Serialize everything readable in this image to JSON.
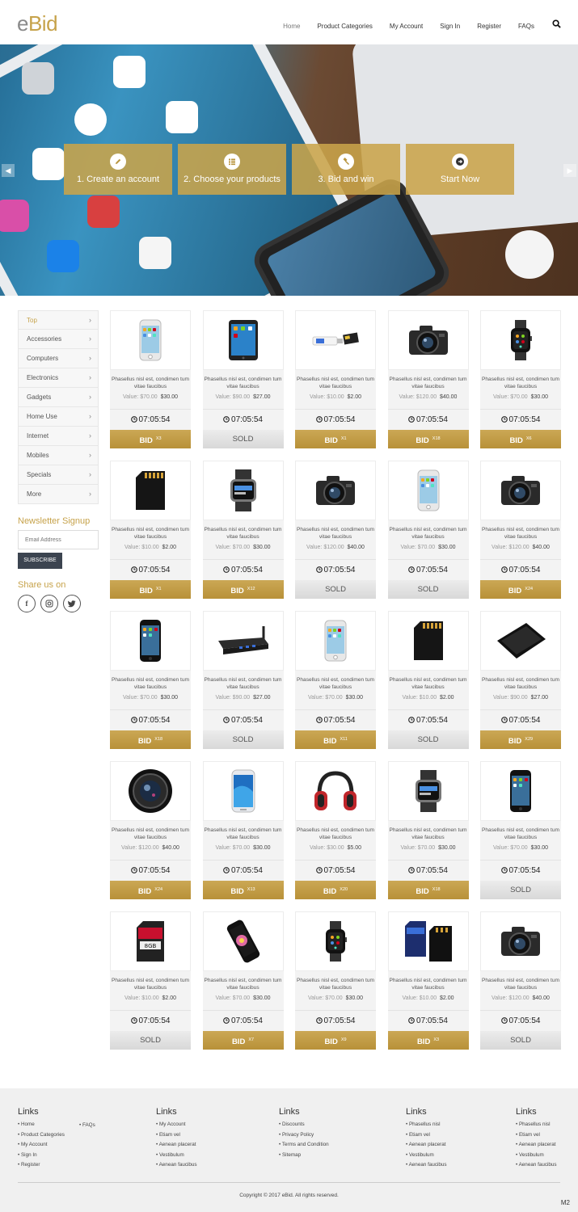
{
  "brand": {
    "logo_e": "e",
    "logo_bid": "Bid",
    "accent": "#c6a24a"
  },
  "nav": {
    "items": [
      "Home",
      "Product Categories",
      "My Account",
      "Sign In",
      "Register",
      "FAQs"
    ],
    "active": "Home"
  },
  "hero": {
    "steps": [
      {
        "label": "1. Create an account",
        "icon": "pencil-icon"
      },
      {
        "label": "2. Choose your products",
        "icon": "list-icon"
      },
      {
        "label": "3. Bid and win",
        "icon": "gavel-icon"
      },
      {
        "label": "Start Now",
        "icon": "arrow-right-circle-icon"
      }
    ]
  },
  "sidebar": {
    "categories": [
      "Top",
      "Accessories",
      "Computers",
      "Electronics",
      "Gadgets",
      "Home Use",
      "Internet",
      "Mobiles",
      "Specials",
      "More"
    ],
    "newsletter_title": "Newsletter Signup",
    "email_placeholder": "Email Address",
    "subscribe_label": "SUBSCRIBE",
    "share_title": "Share us on"
  },
  "products": [
    {
      "type": "iphone-white",
      "desc": "Phasellus nisl est, condimen tum vitae faucibus",
      "old": "Value: $70.00",
      "new": "$30.00",
      "timer": "07:05:54",
      "status": "BID",
      "count": "X3"
    },
    {
      "type": "ipad",
      "desc": "Phasellus nisl est, condimen tum vitae faucibus",
      "old": "Value: $90.00",
      "new": "$27.00",
      "timer": "07:05:54",
      "status": "SOLD",
      "count": ""
    },
    {
      "type": "usb",
      "desc": "Phasellus nisl est, condimen tum vitae faucibus",
      "old": "Value: $10.00",
      "new": "$2.00",
      "timer": "07:05:54",
      "status": "BID",
      "count": "X1"
    },
    {
      "type": "camera",
      "desc": "Phasellus nisl est, condimen tum vitae faucibus",
      "old": "Value: $120.00",
      "new": "$40.00",
      "timer": "07:05:54",
      "status": "BID",
      "count": "X18"
    },
    {
      "type": "watch",
      "desc": "Phasellus nisl est, condimen tum vitae faucibus",
      "old": "Value: $70.00",
      "new": "$30.00",
      "timer": "07:05:54",
      "status": "BID",
      "count": "X6"
    },
    {
      "type": "sdcard",
      "desc": "Phasellus nisl est, condimen tum vitae faucibus",
      "old": "Value: $10.00",
      "new": "$2.00",
      "timer": "07:05:54",
      "status": "BID",
      "count": "X1"
    },
    {
      "type": "smartwatch",
      "desc": "Phasellus nisl est, condimen tum vitae faucibus",
      "old": "Value: $70.00",
      "new": "$30.00",
      "timer": "07:05:54",
      "status": "BID",
      "count": "X12"
    },
    {
      "type": "camera",
      "desc": "Phasellus nisl est, condimen tum vitae faucibus",
      "old": "Value: $120.00",
      "new": "$40.00",
      "timer": "07:05:54",
      "status": "SOLD",
      "count": ""
    },
    {
      "type": "iphone-white",
      "desc": "Phasellus nisl est, condimen tum vitae faucibus",
      "old": "Value: $70.00",
      "new": "$30.00",
      "timer": "07:05:54",
      "status": "SOLD",
      "count": ""
    },
    {
      "type": "camera",
      "desc": "Phasellus nisl est, condimen tum vitae faucibus",
      "old": "Value: $120.00",
      "new": "$40.00",
      "timer": "07:05:54",
      "status": "BID",
      "count": "X24"
    },
    {
      "type": "iphone-black",
      "desc": "Phasellus nisl est, condimen tum vitae faucibus",
      "old": "Value: $70.00",
      "new": "$30.00",
      "timer": "07:05:54",
      "status": "BID",
      "count": "X18"
    },
    {
      "type": "router",
      "desc": "Phasellus nisl est, condimen tum vitae faucibus",
      "old": "Value: $90.00",
      "new": "$27.00",
      "timer": "07:05:54",
      "status": "SOLD",
      "count": ""
    },
    {
      "type": "iphone-white",
      "desc": "Phasellus nisl est, condimen tum vitae faucibus",
      "old": "Value: $70.00",
      "new": "$30.00",
      "timer": "07:05:54",
      "status": "BID",
      "count": "X11"
    },
    {
      "type": "sdcard",
      "desc": "Phasellus nisl est, condimen tum vitae faucibus",
      "old": "Value: $10.00",
      "new": "$2.00",
      "timer": "07:05:54",
      "status": "SOLD",
      "count": ""
    },
    {
      "type": "tablet-black",
      "desc": "Phasellus nisl est, condimen tum vitae faucibus",
      "old": "Value: $90.00",
      "new": "$27.00",
      "timer": "07:05:54",
      "status": "BID",
      "count": "X29"
    },
    {
      "type": "lens",
      "desc": "Phasellus nisl est, condimen tum vitae faucibus",
      "old": "Value: $120.00",
      "new": "$40.00",
      "timer": "07:05:54",
      "status": "BID",
      "count": "X24"
    },
    {
      "type": "galaxy",
      "desc": "Phasellus nisl est, condimen tum vitae faucibus",
      "old": "Value: $70.00",
      "new": "$30.00",
      "timer": "07:05:54",
      "status": "BID",
      "count": "X13"
    },
    {
      "type": "headphones",
      "desc": "Phasellus nisl est, condimen tum vitae faucibus",
      "old": "Value: $30.00",
      "new": "$5.00",
      "timer": "07:05:54",
      "status": "BID",
      "count": "X20"
    },
    {
      "type": "smartwatch",
      "desc": "Phasellus nisl est, condimen tum vitae faucibus",
      "old": "Value: $70.00",
      "new": "$30.00",
      "timer": "07:05:54",
      "status": "BID",
      "count": "X18"
    },
    {
      "type": "iphone-black",
      "desc": "Phasellus nisl est, condimen tum vitae faucibus",
      "old": "Value: $70.00",
      "new": "$30.00",
      "timer": "07:05:54",
      "status": "SOLD",
      "count": ""
    },
    {
      "type": "sdcard-red",
      "desc": "Phasellus nisl est, condimen tum vitae faucibus",
      "old": "Value: $10.00",
      "new": "$2.00",
      "timer": "07:05:54",
      "status": "SOLD",
      "count": ""
    },
    {
      "type": "phone-flower",
      "desc": "Phasellus nisl est, condimen tum vitae faucibus",
      "old": "Value: $70.00",
      "new": "$30.00",
      "timer": "07:05:54",
      "status": "BID",
      "count": "X7"
    },
    {
      "type": "watch",
      "desc": "Phasellus nisl est, condimen tum vitae faucibus",
      "old": "Value: $70.00",
      "new": "$30.00",
      "timer": "07:05:54",
      "status": "BID",
      "count": "X9"
    },
    {
      "type": "sdcards",
      "desc": "Phasellus nisl est, condimen tum vitae faucibus",
      "old": "Value: $10.00",
      "new": "$2.00",
      "timer": "07:05:54",
      "status": "BID",
      "count": "X3"
    },
    {
      "type": "camera",
      "desc": "Phasellus nisl est, condimen tum vitae faucibus",
      "old": "Value: $120.00",
      "new": "$40.00",
      "timer": "07:05:54",
      "status": "SOLD",
      "count": ""
    }
  ],
  "footer": {
    "columns": [
      {
        "title": "Links",
        "items": [
          "Home",
          "Product Categories",
          "My Account",
          "Sign In",
          "Register"
        ]
      },
      {
        "title": "",
        "items": [
          "FAQs"
        ]
      },
      {
        "title": "Links",
        "items": [
          "My Account",
          "Etiam vel",
          "Aenean placerat",
          "Vestibulum",
          "Aenean faucibus"
        ]
      },
      {
        "title": "Links",
        "items": [
          "Discounts",
          "Privacy Policy",
          "Terms and Condition",
          "Sitemap"
        ]
      },
      {
        "title": "Links",
        "items": [
          "Phasellus nisl",
          "Etiam vel",
          "Aenean placerat",
          "Vestibulum",
          "Aenean faucibus"
        ]
      },
      {
        "title": "Links",
        "items": [
          "Phasellus nisl",
          "Etiam vel",
          "Aenean placerat",
          "Vestibulum",
          "Aenean faucibus"
        ]
      }
    ],
    "copyright": "Copyright  ©  2017  eBid. All rights reserved.",
    "badge": "M2"
  }
}
